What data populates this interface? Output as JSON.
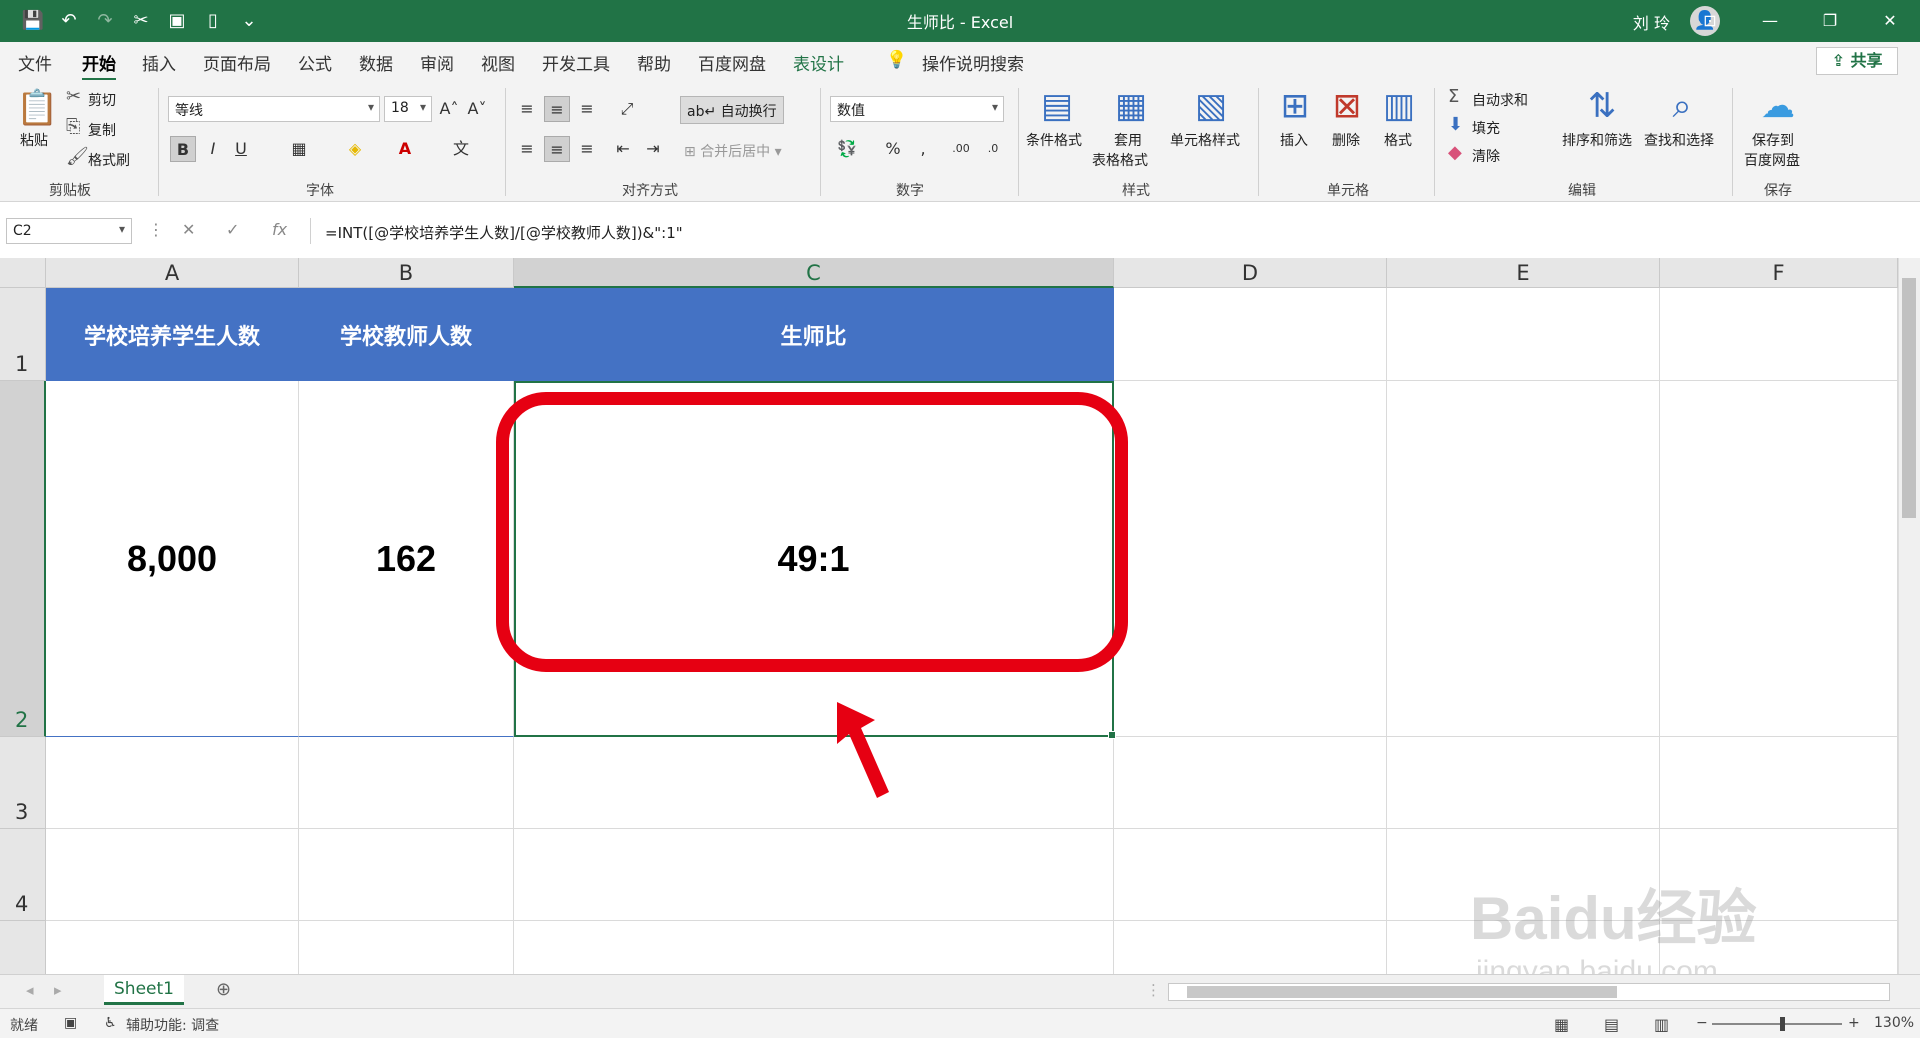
{
  "window": {
    "doc_title": "生师比  -  Excel",
    "user": "刘 玲"
  },
  "ribbon_tabs": [
    "文件",
    "开始",
    "插入",
    "页面布局",
    "公式",
    "数据",
    "审阅",
    "视图",
    "开发工具",
    "帮助",
    "百度网盘",
    "表设计"
  ],
  "active_tab": "开始",
  "search_label": "操作说明搜索",
  "share_label": "共享",
  "clipboard": {
    "paste": "粘贴",
    "cut": "剪切",
    "copy": "复制",
    "format_painter": "格式刷",
    "group": "剪贴板"
  },
  "font": {
    "name": "等线",
    "size": "18",
    "group": "字体",
    "bold": "B",
    "italic": "I",
    "underline": "U"
  },
  "alignment": {
    "wrap": "自动换行",
    "merge": "合并后居中",
    "group": "对齐方式"
  },
  "number": {
    "format": "数值",
    "group": "数字"
  },
  "styles": {
    "conditional": "条件格式",
    "table_fmt_1": "套用",
    "table_fmt_2": "表格格式",
    "cell_styles": "单元格样式",
    "group": "样式"
  },
  "cells": {
    "insert": "插入",
    "delete": "删除",
    "format": "格式",
    "group": "单元格"
  },
  "editing": {
    "autosum": "自动求和",
    "fill": "填充",
    "clear": "清除",
    "sort": "排序和筛选",
    "find": "查找和选择",
    "group": "编辑"
  },
  "save": {
    "label_1": "保存到",
    "label_2": "百度网盘",
    "group": "保存"
  },
  "formula_bar": {
    "name_box": "C2",
    "formula": "=INT([@学校培养学生人数]/[@学校教师人数])&\":1\""
  },
  "columns": [
    "A",
    "B",
    "C",
    "D",
    "E",
    "F"
  ],
  "rows": [
    "1",
    "2",
    "3",
    "4"
  ],
  "table": {
    "headers": [
      "学校培养学生人数",
      "学校教师人数",
      "生师比"
    ],
    "row": [
      "8,000",
      "162",
      "49:1"
    ]
  },
  "sheet_tab": "Sheet1",
  "status": {
    "ready": "就绪",
    "accessibility": "辅助功能: 调查",
    "zoom": "130%"
  },
  "watermark": {
    "brand": "Baidu经验",
    "url": "jingyan.baidu.com"
  },
  "colors": {
    "excel_green": "#217346",
    "header_fill": "#4472c4",
    "highlight": "#e60012"
  }
}
